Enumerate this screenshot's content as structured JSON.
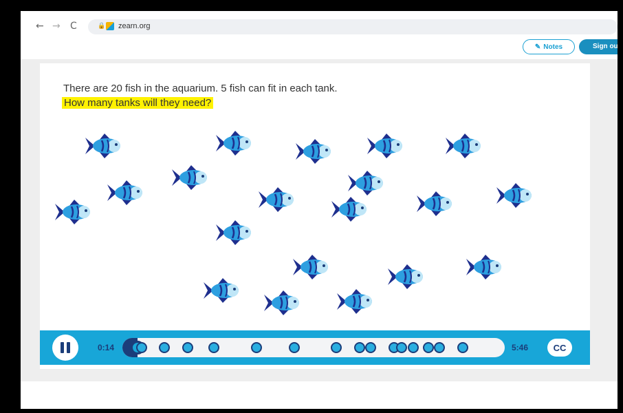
{
  "browser": {
    "url": "zearn.org",
    "back_icon": "←",
    "forward_icon": "→",
    "reload_icon": "C"
  },
  "topbar": {
    "notes_label": "Notes",
    "signout_label": "Sign out"
  },
  "question": {
    "line1": "There are 20 fish in the aquarium. 5 fish can fit in each tank.",
    "line2": "How many tanks will they need?"
  },
  "fish": {
    "count": 20,
    "icon": "fish-icon",
    "body_color": "#2d9fe0",
    "fin_color": "#1e2f8e"
  },
  "player": {
    "current_time": "0:14",
    "total_time": "5:46",
    "cc_label": "CC",
    "progress": 0.04,
    "marker_positions": [
      0.05,
      0.11,
      0.17,
      0.24,
      0.35,
      0.45,
      0.56,
      0.62,
      0.65,
      0.71,
      0.73,
      0.76,
      0.8,
      0.83,
      0.89
    ]
  },
  "colors": {
    "accent": "#18a6d8",
    "navy": "#1b3d7a",
    "highlight": "#fff200"
  }
}
